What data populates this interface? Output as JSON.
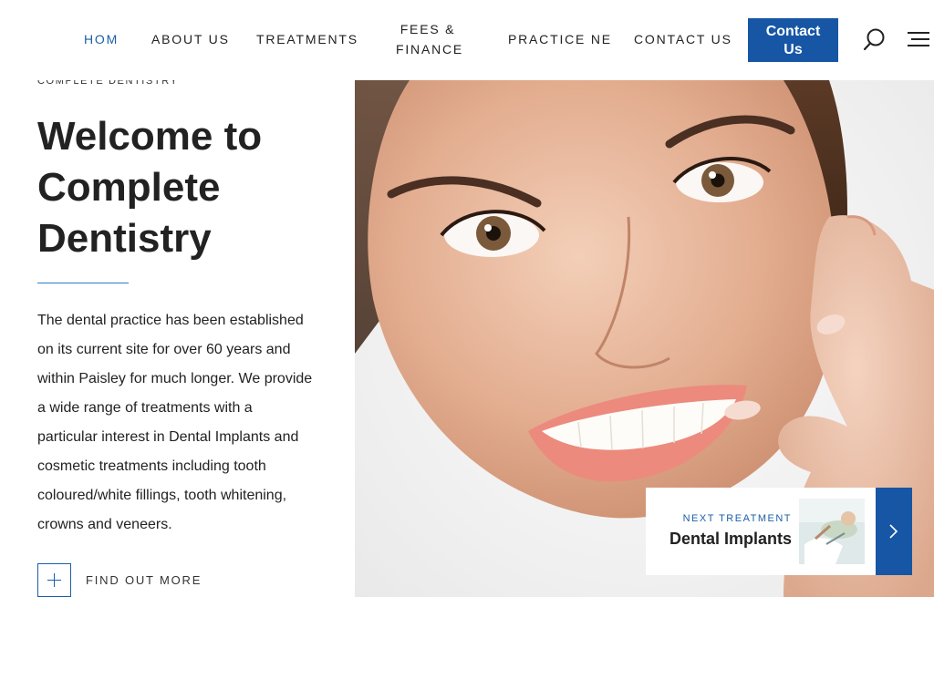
{
  "nav": {
    "items": [
      {
        "label": "HOM",
        "active": true
      },
      {
        "label": "ABOUT US"
      },
      {
        "label": "TREATMENTS"
      },
      {
        "label_line1": "FEES &",
        "label_line2": "FINANCE"
      },
      {
        "label": "PRACTICE NE"
      },
      {
        "label": "CONTACT US"
      }
    ],
    "contact_button": {
      "line1": "Contact",
      "line2": "Us"
    },
    "icons": [
      "search-icon",
      "hamburger-menu-icon"
    ]
  },
  "hero": {
    "eyebrow": "COMPLETE DENTISTRY",
    "title_line1": "Welcome to",
    "title_line2": "Complete",
    "title_line3": "Dentistry",
    "intro": "The dental practice has been established on its current site for over 60 years and within Paisley for much longer. We provide a wide range of treatments with a particular interest in Dental Implants and cosmetic treatments including tooth coloured/white fillings, tooth whitening, crowns and veneers.",
    "find_out_more": "FIND OUT MORE"
  },
  "next_treatment": {
    "kicker": "NEXT TREATMENT",
    "title": "Dental Implants"
  },
  "colors": {
    "accent": "#1656a5",
    "active_nav": "#1b5fa8",
    "rule": "#2b7cc4",
    "text": "#222222"
  }
}
